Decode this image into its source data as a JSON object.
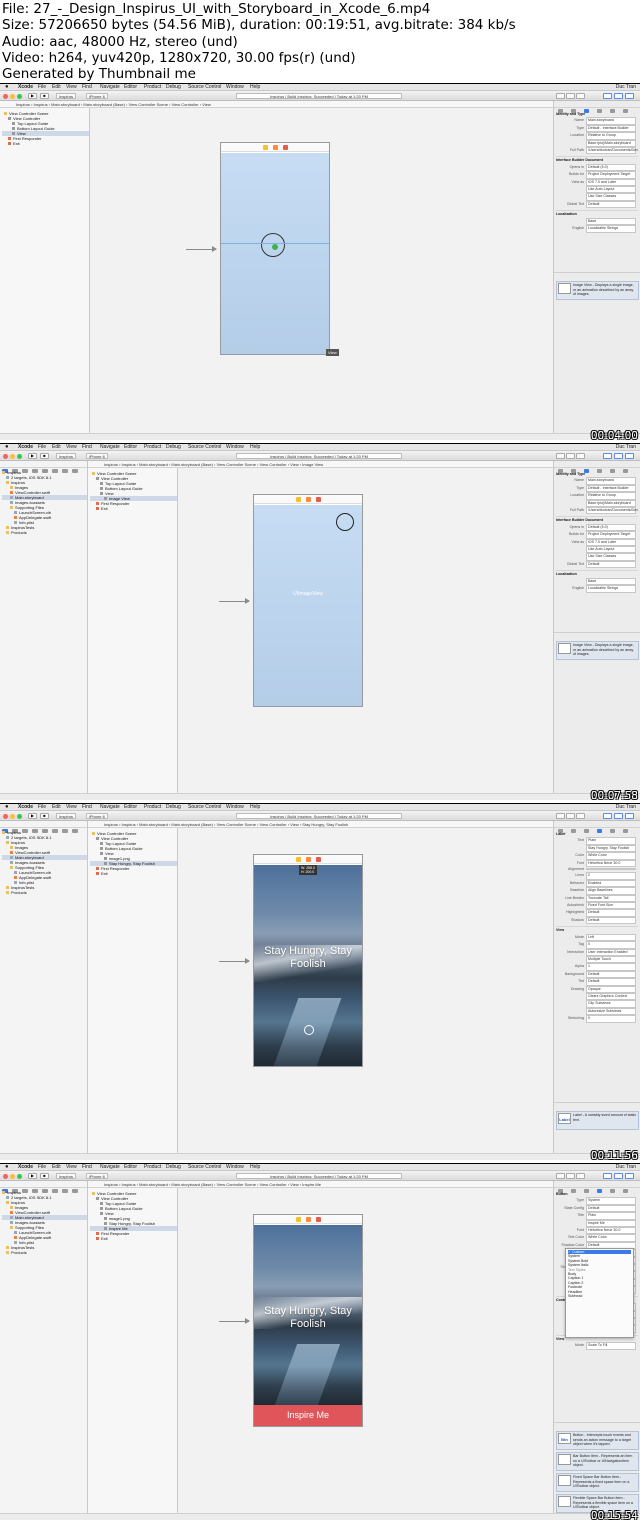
{
  "file_info": {
    "line1": "File: 27_-_Design_Inspirus_UI_with_Storyboard_in_Xcode_6.mp4",
    "line2": "Size: 57206650 bytes (54.56 MiB), duration: 00:19:51, avg.bitrate: 384 kb/s",
    "line3": "Audio: aac, 48000 Hz, stereo (und)",
    "line4": "Video: h264, yuv420p, 1280x720, 30.00 fps(r) (und)",
    "line5": "Generated by Thumbnail me"
  },
  "menu": {
    "app": "Xcode",
    "items": [
      "File",
      "Edit",
      "View",
      "Find",
      "Navigate",
      "Editor",
      "Product",
      "Debug",
      "Source Control",
      "Window",
      "Help"
    ],
    "right": "Duc Tran"
  },
  "toolbar": {
    "scheme": "Inspirus",
    "device": "iPhone 6",
    "status": "Inspirus | Build Inspirus: Succeeded | Today at 1:20 PM"
  },
  "frames": [
    {
      "timestamp": "00:04:00",
      "jump": "Inspirus › Inspirus › Main.storyboard › Main.storyboard (Base) › View Controller Scene › View Controller › View",
      "project_tree": [],
      "outline": [
        "View Controller Scene",
        "  View Controller",
        "    Top Layout Guide",
        "    Bottom Layout Guide",
        "    View",
        "  First Responder",
        "  Exit"
      ],
      "outline_selected": 4,
      "inspector_title": "Identity and Type",
      "inspector_rows": [
        [
          "Name",
          "Main.storyboard"
        ],
        [
          "Type",
          "Default - Interface Builder"
        ],
        [
          "Location",
          "Relative to Group"
        ],
        [
          "",
          "Base.lproj/Main.storyboard"
        ],
        [
          "Full Path",
          "/Users/ductran/Documents/Developer/iOS/Inspirus"
        ]
      ],
      "ib_title": "Interface Builder Document",
      "ib_rows": [
        [
          "Opens in",
          "Default (6.0)"
        ],
        [
          "Builds for",
          "Project Deployment Target"
        ],
        [
          "View as",
          "iOS 7.0 and Later"
        ],
        [
          "",
          "Use Auto Layout"
        ],
        [
          "",
          "Use Size Classes"
        ],
        [
          "Global Tint",
          "Default"
        ]
      ],
      "loc_title": "Localization",
      "loc_rows": [
        [
          "",
          "Base"
        ],
        [
          "English",
          "Localizable Strings"
        ]
      ],
      "lib_items": [
        {
          "title": "Image View",
          "desc": "Image View - Displays a single image, or an animation described by an array of images."
        }
      ],
      "canvas_label": "View"
    },
    {
      "timestamp": "00:07:58",
      "jump": "Inspirus › Inspirus › Main.storyboard › Main.storyboard (Base) › View Controller Scene › View Controller › View › Image View",
      "project_tree": [
        "Inspirus",
        "  2 targets, iOS SDK 8.1",
        "  Inspirus",
        "    Images",
        "    ViewController.swift",
        "    Main.storyboard",
        "    Images.xcassets",
        "    Supporting Files",
        "      LaunchScreen.xib",
        "      AppDelegate.swift",
        "      Info.plist",
        "  InspirusTests",
        "  Products"
      ],
      "project_selected": 5,
      "outline": [
        "View Controller Scene",
        "  View Controller",
        "    Top Layout Guide",
        "    Bottom Layout Guide",
        "    View",
        "      Image View",
        "  First Responder",
        "  Exit"
      ],
      "outline_selected": 5,
      "inspector_title": "Identity and Type",
      "inspector_rows": [
        [
          "Name",
          "Main.storyboard"
        ],
        [
          "Type",
          "Default - Interface Builder"
        ],
        [
          "Location",
          "Relative to Group"
        ],
        [
          "",
          "Base.lproj/Main.storyboard"
        ],
        [
          "Full Path",
          "/Users/ductran/Documents/Developer/iOS/Inspirus"
        ]
      ],
      "ib_title": "Interface Builder Document",
      "ib_rows": [
        [
          "Opens in",
          "Default (6.0)"
        ],
        [
          "Builds for",
          "Project Deployment Target"
        ],
        [
          "View as",
          "iOS 7.0 and Later"
        ],
        [
          "",
          "Use Auto Layout"
        ],
        [
          "",
          "Use Size Classes"
        ],
        [
          "Global Tint",
          "Default"
        ]
      ],
      "loc_title": "Localization",
      "loc_rows": [
        [
          "",
          "Base"
        ],
        [
          "English",
          "Localizable Strings"
        ]
      ],
      "lib_items": [
        {
          "title": "Image View",
          "desc": "Image View - Displays a single image, or an animation described by an array of images."
        }
      ],
      "canvas_label": "UIImageView"
    },
    {
      "timestamp": "00:11:56",
      "jump": "Inspirus › Inspirus › Main.storyboard › Main.storyboard (Base) › View Controller Scene › View Controller › View › Stay Hungry, Stay Foolish",
      "project_tree": [
        "Inspirus",
        "  2 targets, iOS SDK 8.1",
        "  Inspirus",
        "    Images",
        "    ViewController.swift",
        "    Main.storyboard",
        "    Images.xcassets",
        "    Supporting Files",
        "      LaunchScreen.xib",
        "      AppDelegate.swift",
        "      Info.plist",
        "  InspirusTests",
        "  Products"
      ],
      "project_selected": 5,
      "outline": [
        "View Controller Scene",
        "  View Controller",
        "    Top Layout Guide",
        "    Bottom Layout Guide",
        "    View",
        "      image1.png",
        "      Stay Hungry, Stay Foolish",
        "  First Responder",
        "  Exit"
      ],
      "outline_selected": 6,
      "inspector_title": "Label",
      "inspector_rows": [
        [
          "Text",
          "Plain"
        ],
        [
          "",
          "Stay Hungry, Stay Foolish"
        ],
        [
          "Color",
          "White Color"
        ],
        [
          "Font",
          "Helvetica Neue 30.0"
        ],
        [
          "Alignment",
          ""
        ],
        [
          "Lines",
          "2"
        ],
        [
          "Behavior",
          "Enabled"
        ],
        [
          "Baseline",
          "Align Baselines"
        ],
        [
          "Line Breaks",
          "Truncate Tail"
        ],
        [
          "Autoshrink",
          "Fixed Font Size"
        ],
        [
          "Highlighted",
          "Default"
        ],
        [
          "Shadow",
          "Default"
        ]
      ],
      "ib_title": "View",
      "ib_rows": [
        [
          "Mode",
          "Left"
        ],
        [
          "Tag",
          "0"
        ],
        [
          "Interaction",
          "User Interaction Enabled"
        ],
        [
          "",
          "Multiple Touch"
        ],
        [
          "Alpha",
          "1"
        ],
        [
          "Background",
          "Default"
        ],
        [
          "Tint",
          "Default"
        ],
        [
          "Drawing",
          "Opaque"
        ],
        [
          "",
          "Clears Graphics Context"
        ],
        [
          "",
          "Clip Subviews"
        ],
        [
          "",
          "Autoresize Subviews"
        ],
        [
          "Stretching",
          "0"
        ]
      ],
      "loc_title": "",
      "loc_rows": [],
      "lib_items": [
        {
          "title": "Label",
          "desc": "Label - A variably sized amount of static text."
        }
      ],
      "canvas_label": "Stay Hungry, Stay Foolish",
      "size_tip": "W: 288.0\nH: 200.0"
    },
    {
      "timestamp": "00:15:54",
      "jump": "Inspirus › Inspirus › Main.storyboard › Main.storyboard (Base) › View Controller Scene › View Controller › View › Inspire Me",
      "project_tree": [
        "Inspirus",
        "  2 targets, iOS SDK 8.1",
        "  Inspirus",
        "    Images",
        "    ViewController.swift",
        "    Main.storyboard",
        "    Images.xcassets",
        "    Supporting Files",
        "      LaunchScreen.xib",
        "      AppDelegate.swift",
        "      Info.plist",
        "  InspirusTests",
        "  Products"
      ],
      "project_selected": 5,
      "outline": [
        "View Controller Scene",
        "  View Controller",
        "    Top Layout Guide",
        "    Bottom Layout Guide",
        "    View",
        "      image1.png",
        "      Stay Hungry, Stay Foolish",
        "      Inspire Me",
        "  First Responder",
        "  Exit"
      ],
      "outline_selected": 7,
      "inspector_title": "Button",
      "inspector_rows": [
        [
          "Type",
          "System"
        ],
        [
          "State Config",
          "Default"
        ],
        [
          "Title",
          "Plain"
        ],
        [
          "",
          "Inspire Me"
        ],
        [
          "Font",
          "Helvetica Neue 30.0"
        ],
        [
          "Text Color",
          "White Color"
        ],
        [
          "Shadow Color",
          "Default"
        ],
        [
          "Image",
          "Image"
        ],
        [
          "Background",
          "Background Image"
        ],
        [
          "Shadow Offset",
          "0"
        ],
        [
          "Line Break",
          "Truncate Middle"
        ],
        [
          "Edge",
          "Content"
        ],
        [
          "Inset",
          "0"
        ]
      ],
      "ib_title": "Control",
      "ib_rows": [
        [
          "Alignment",
          "Horizontal"
        ],
        [
          "",
          "Vertical"
        ],
        [
          "Content",
          "Selected"
        ],
        [
          "",
          "Highlighted"
        ]
      ],
      "loc_title": "View",
      "loc_rows": [
        [
          "Mode",
          "Scale To Fill"
        ]
      ],
      "lib_items": [
        {
          "title": "Button",
          "desc": "Button - Intercepts touch events and sends an action message to a target object when it's tapped."
        },
        {
          "title": "Bar Button Item",
          "desc": "Bar Button Item - Represents an item on a UIToolbar or UINavigationItem object."
        },
        {
          "title": "Fixed Space Bar Button Item",
          "desc": "Fixed Space Bar Button Item - Represents a fixed space item on a UIToolbar object."
        },
        {
          "title": "Flexible Space Bar Button Item",
          "desc": "Flexible Space Bar Button Item - Represents a flexible space item on a UIToolbar object."
        }
      ],
      "canvas_label": "Stay Hungry, Stay Foolish",
      "button_label": "Inspire Me",
      "font_popup": {
        "items": [
          "Custom",
          "System",
          "System Bold",
          "System Italic",
          "Text Styles",
          "Body",
          "Caption 1",
          "Caption 2",
          "Footnote",
          "Headline",
          "Subhead"
        ],
        "selected": 0,
        "headers": [
          4
        ]
      }
    }
  ]
}
